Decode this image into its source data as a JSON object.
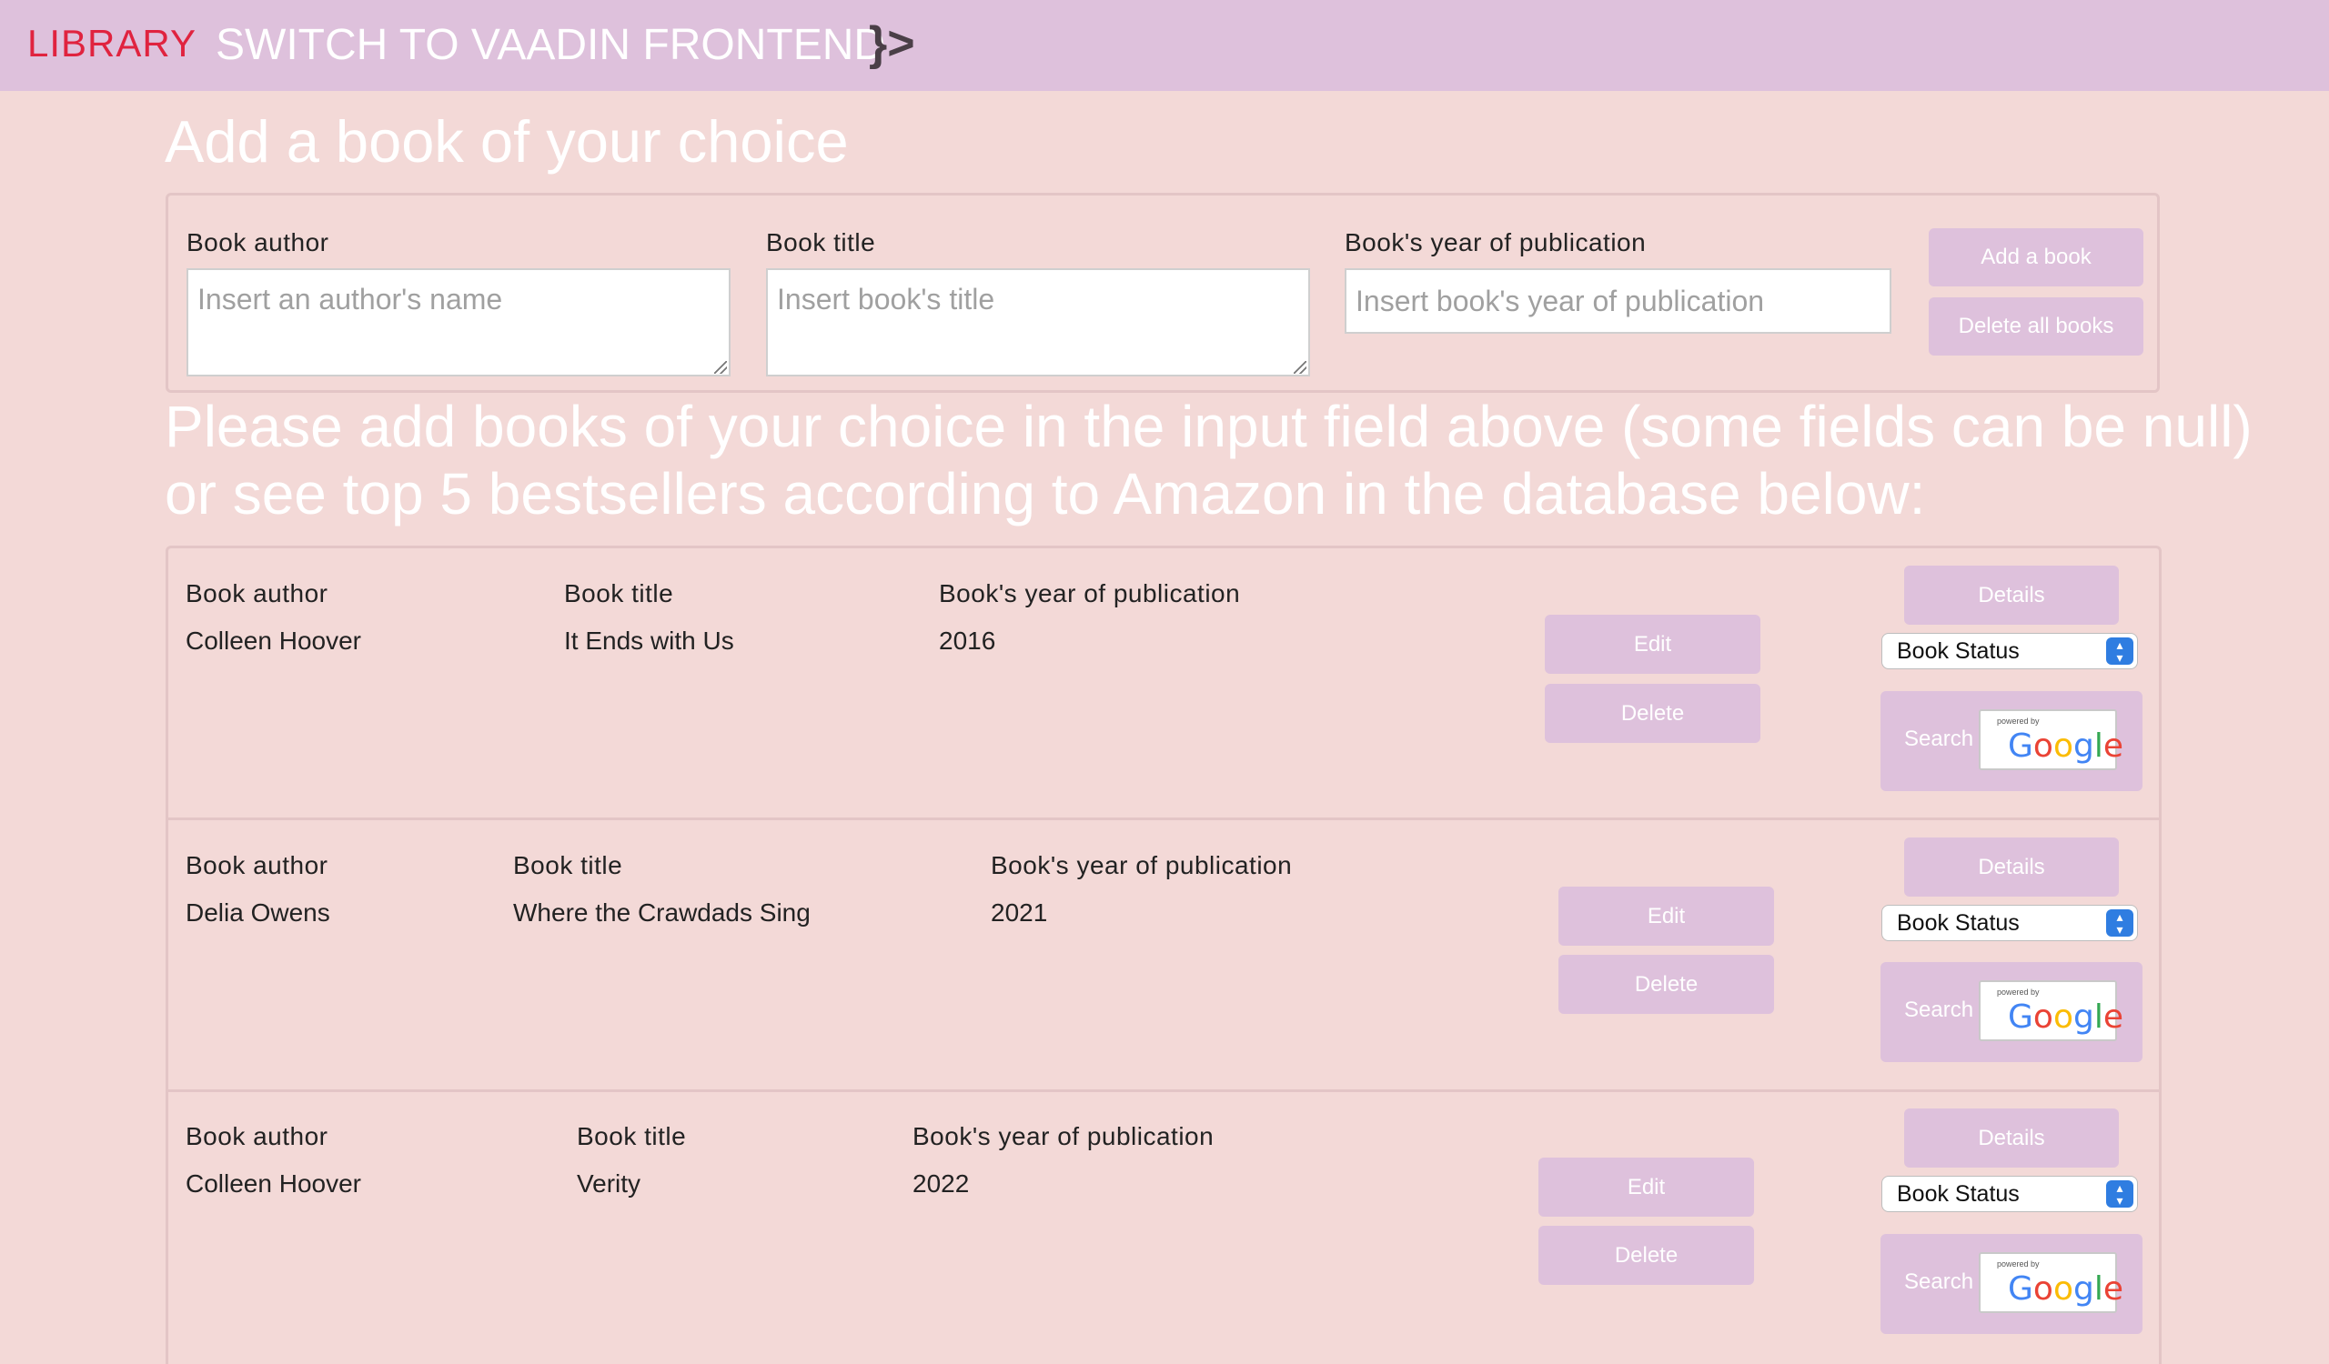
{
  "nav": {
    "brand": "LIBRARY",
    "switch_label": "SWITCH TO VAADIN FRONTEND",
    "switch_logo": "}>"
  },
  "form": {
    "heading": "Add a book of your choice",
    "author_label": "Book author",
    "author_placeholder": "Insert an author's name",
    "title_label": "Book title",
    "title_placeholder": "Insert book's title",
    "year_label": "Book's year of publication",
    "year_placeholder": "Insert book's year of publication",
    "add_button": "Add a book",
    "delete_all_button": "Delete all books"
  },
  "info_text": "Please add books of your choice in the input field above (some fields can be null) or see top 5 bestsellers according to Amazon in the database below:",
  "books": [
    {
      "author_label": "Book author",
      "author": "Colleen Hoover",
      "title_label": "Book title",
      "title": "It Ends with Us",
      "year_label": "Book's year of publication",
      "year": "2016",
      "edit": "Edit",
      "delete": "Delete",
      "details": "Details",
      "status": "Book Status",
      "search": "Search",
      "powered_by": "powered by"
    },
    {
      "author_label": "Book author",
      "author": "Delia Owens",
      "title_label": "Book title",
      "title": "Where the Crawdads Sing",
      "year_label": "Book's year of publication",
      "year": "2021",
      "edit": "Edit",
      "delete": "Delete",
      "details": "Details",
      "status": "Book Status",
      "search": "Search",
      "powered_by": "powered by"
    },
    {
      "author_label": "Book author",
      "author": "Colleen Hoover",
      "title_label": "Book title",
      "title": "Verity",
      "year_label": "Book's year of publication",
      "year": "2022",
      "edit": "Edit",
      "delete": "Delete",
      "details": "Details",
      "status": "Book Status",
      "search": "Search",
      "powered_by": "powered by"
    }
  ],
  "colors": {
    "page_bg": "#f3d9d7",
    "header_bg": "#dec1dc",
    "button_bg": "#dec1dc",
    "brand": "#e0233f",
    "select_accent": "#2f7de1"
  }
}
